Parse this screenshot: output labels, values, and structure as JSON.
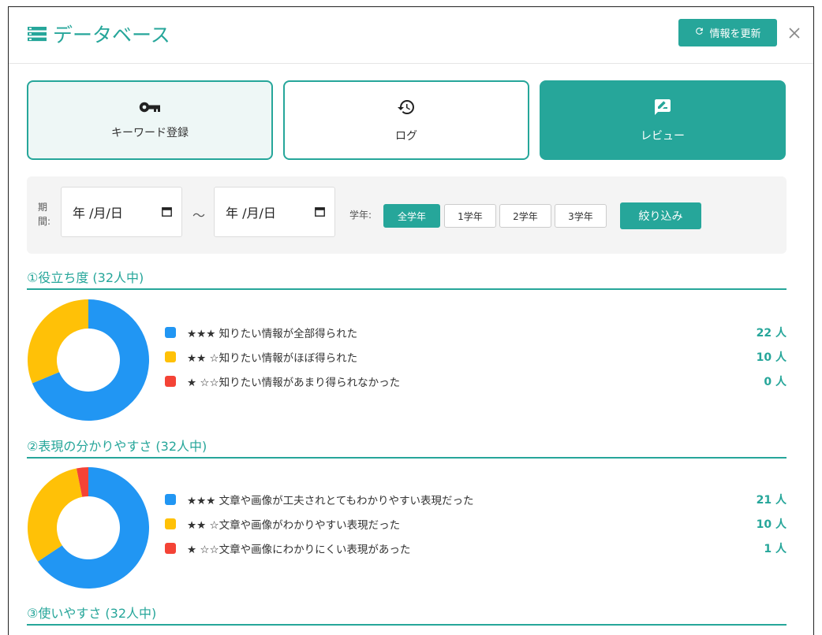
{
  "header": {
    "title": "データベース",
    "refresh_label": "情報を更新"
  },
  "tabs": [
    {
      "label": "キーワード登録",
      "icon": "key-icon"
    },
    {
      "label": "ログ",
      "icon": "history-icon"
    },
    {
      "label": "レビュー",
      "icon": "rate-review-icon"
    }
  ],
  "filter": {
    "period_label": "期間:",
    "date_from": "年 /月/日",
    "date_to": "年 /月/日",
    "tilde": "～",
    "grade_label": "学年:",
    "grades": [
      "全学年",
      "1学年",
      "2学年",
      "3学年"
    ],
    "active_grade": "全学年",
    "submit_label": "絞り込み"
  },
  "colors": {
    "accent": "#26a69a",
    "blue": "#2196f3",
    "yellow": "#ffc107",
    "red": "#f44336"
  },
  "sections": [
    {
      "title": "①役立ち度 (32人中)",
      "items": [
        {
          "label": "★★★ 知りたい情報が全部得られた",
          "count": "22 人",
          "value": 22,
          "color": "#2196f3"
        },
        {
          "label": "★★ ☆知りたい情報がほぼ得られた",
          "count": "10 人",
          "value": 10,
          "color": "#ffc107"
        },
        {
          "label": "★ ☆☆知りたい情報があまり得られなかった",
          "count": "0 人",
          "value": 0,
          "color": "#f44336"
        }
      ]
    },
    {
      "title": "②表現の分かりやすさ (32人中)",
      "items": [
        {
          "label": "★★★ 文章や画像が工夫されとてもわかりやすい表現だった",
          "count": "21 人",
          "value": 21,
          "color": "#2196f3"
        },
        {
          "label": "★★ ☆文章や画像がわかりやすい表現だった",
          "count": "10 人",
          "value": 10,
          "color": "#ffc107"
        },
        {
          "label": "★ ☆☆文章や画像にわかりにくい表現があった",
          "count": "1 人",
          "value": 1,
          "color": "#f44336"
        }
      ]
    },
    {
      "title": "③使いやすさ (32人中)",
      "items": []
    }
  ]
}
